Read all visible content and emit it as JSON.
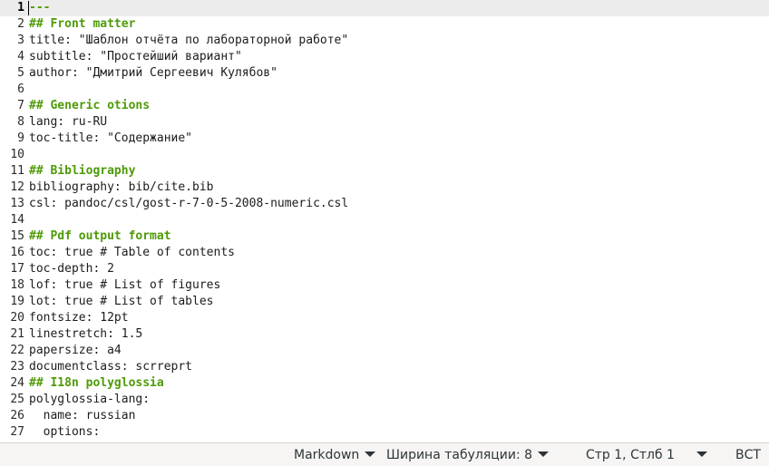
{
  "editor": {
    "lines": [
      {
        "num": "1",
        "text": "---",
        "kind": "rule"
      },
      {
        "num": "2",
        "text": "## Front matter",
        "kind": "heading"
      },
      {
        "num": "3",
        "text": "title: \"Шаблон отчёта по лабораторной работе\"",
        "kind": "plain"
      },
      {
        "num": "4",
        "text": "subtitle: \"Простейший вариант\"",
        "kind": "plain"
      },
      {
        "num": "5",
        "text": "author: \"Дмитрий Сергеевич Кулябов\"",
        "kind": "plain"
      },
      {
        "num": "6",
        "text": "",
        "kind": "plain"
      },
      {
        "num": "7",
        "text": "## Generic otions",
        "kind": "heading"
      },
      {
        "num": "8",
        "text": "lang: ru-RU",
        "kind": "plain"
      },
      {
        "num": "9",
        "text": "toc-title: \"Содержание\"",
        "kind": "plain"
      },
      {
        "num": "10",
        "text": "",
        "kind": "plain"
      },
      {
        "num": "11",
        "text": "## Bibliography",
        "kind": "heading"
      },
      {
        "num": "12",
        "text": "bibliography: bib/cite.bib",
        "kind": "plain"
      },
      {
        "num": "13",
        "text": "csl: pandoc/csl/gost-r-7-0-5-2008-numeric.csl",
        "kind": "plain"
      },
      {
        "num": "14",
        "text": "",
        "kind": "plain"
      },
      {
        "num": "15",
        "text": "## Pdf output format",
        "kind": "heading"
      },
      {
        "num": "16",
        "text": "toc: true # Table of contents",
        "kind": "plain"
      },
      {
        "num": "17",
        "text": "toc-depth: 2",
        "kind": "plain"
      },
      {
        "num": "18",
        "text": "lof: true # List of figures",
        "kind": "plain"
      },
      {
        "num": "19",
        "text": "lot: true # List of tables",
        "kind": "plain"
      },
      {
        "num": "20",
        "text": "fontsize: 12pt",
        "kind": "plain"
      },
      {
        "num": "21",
        "text": "linestretch: 1.5",
        "kind": "plain"
      },
      {
        "num": "22",
        "text": "papersize: a4",
        "kind": "plain"
      },
      {
        "num": "23",
        "text": "documentclass: scrreprt",
        "kind": "plain"
      },
      {
        "num": "24",
        "text": "## I18n polyglossia",
        "kind": "heading"
      },
      {
        "num": "25",
        "text": "polyglossia-lang:",
        "kind": "plain"
      },
      {
        "num": "26",
        "text": "  name: russian",
        "kind": "plain"
      },
      {
        "num": "27",
        "text": "  options:",
        "kind": "plain"
      }
    ],
    "current_line": "1"
  },
  "statusbar": {
    "language": "Markdown",
    "tab_width": "Ширина табуляции: 8",
    "position": "Стр 1, Стлб 1",
    "insert_mode": "ВСТ"
  },
  "colors": {
    "heading": "#4e9a06",
    "current_line_bg": "#ececec",
    "statusbar_bg": "#f6f5f4"
  }
}
